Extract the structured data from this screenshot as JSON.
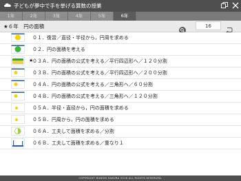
{
  "app": {
    "title": "子どもが夢中で手を挙げる算数の授業"
  },
  "tabs": [
    {
      "label": "1年",
      "active": false
    },
    {
      "label": "2年",
      "active": false
    },
    {
      "label": "3年",
      "active": false
    },
    {
      "label": "4年",
      "active": false
    },
    {
      "label": "5年",
      "active": false
    },
    {
      "label": "6年",
      "active": true
    }
  ],
  "toolbar": {
    "current": "★６年　円の面積",
    "count": "16",
    "search_icon": "search-icon",
    "back_icon": "return-icon"
  },
  "lessons": [
    {
      "label": "０１．復習／直径・半径から，円周を求める",
      "starred": false,
      "thumb": "circle-yellow"
    },
    {
      "label": "０２．円の面積を考える",
      "starred": false,
      "thumb": "circle-green"
    },
    {
      "label": "０３Ａ．円の面積の公式を考える／平行四辺形へ／１２０分割",
      "starred": true,
      "thumb": "strip-yellow"
    },
    {
      "label": "０３Ｂ．円の面積の公式を考える／平行四辺形へ／２００分割",
      "starred": false,
      "thumb": "dot-yellow"
    },
    {
      "label": "０４Ａ．円の面積の公式を考える／三角形へ／６０分割",
      "starred": false,
      "thumb": "dot-yellow"
    },
    {
      "label": "０４Ｂ．円の面積の公式を考える／三角形へ／１２０分割",
      "starred": false,
      "thumb": "dot-yellow"
    },
    {
      "label": "０５Ａ．半径・直径から，円の面積を求める",
      "starred": false,
      "thumb": "circle-small"
    },
    {
      "label": "０５Ｂ．円周から，円の面積を求める",
      "starred": false,
      "thumb": "circle-small"
    },
    {
      "label": "０６Ａ．工夫して面積を求める／分割",
      "starred": false,
      "thumb": "half-green"
    },
    {
      "label": "０６Ｂ．工夫して面積を求める／重なり１",
      "starred": false,
      "thumb": "shape-blue"
    }
  ],
  "footer": {
    "copyright": "COPYRIGHT BUNSHI SAKURA 2016 ALL RIGHTS RESERVED."
  },
  "colors": {
    "titlebar": "#4f4f4f",
    "tab": "#8d8d8d",
    "tab_active": "#5b5b5b"
  }
}
